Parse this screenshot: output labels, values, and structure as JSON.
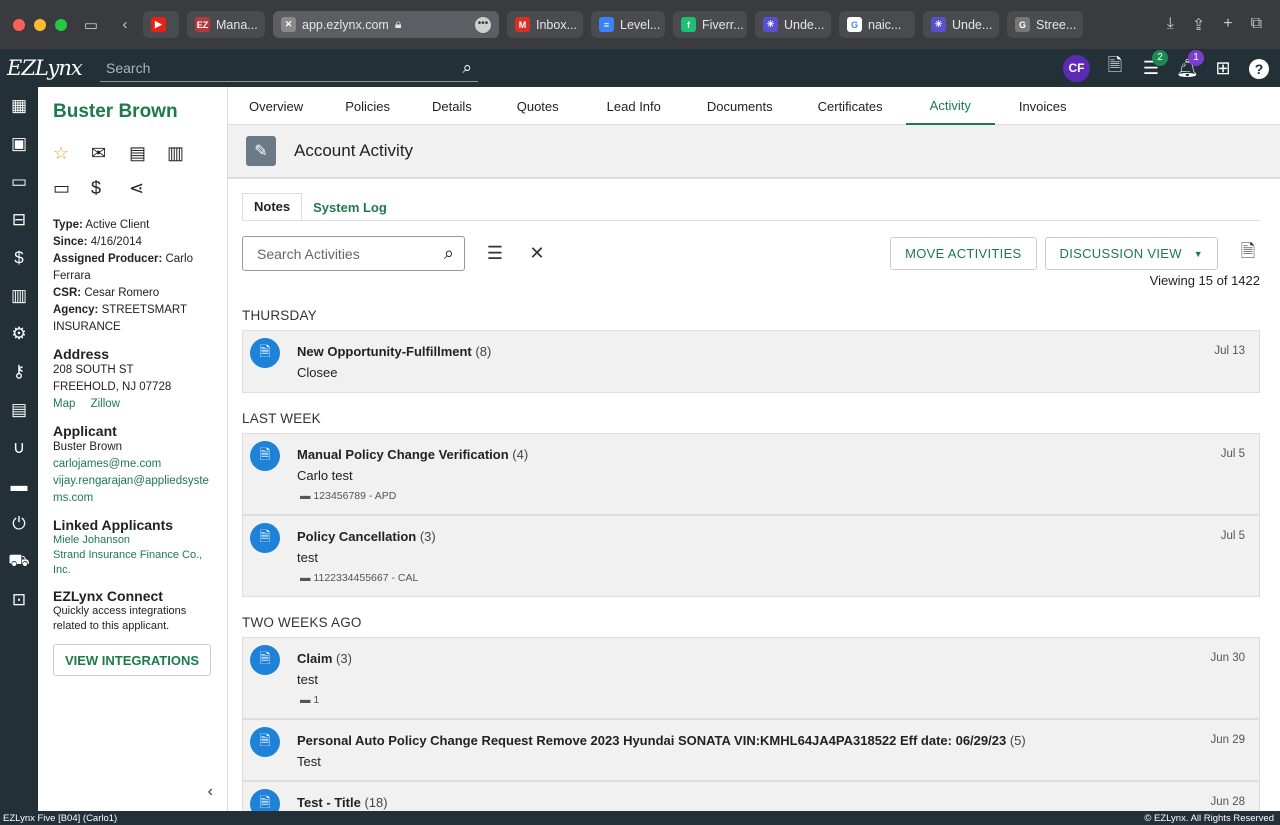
{
  "browser": {
    "tabs": [
      {
        "label": "",
        "fav_color": "#e62117",
        "fav_glyph": "▶"
      },
      {
        "label": "Mana...",
        "fav_color": "#b23a3a",
        "fav_glyph": "EZ"
      },
      {
        "label": "Inbox...",
        "fav_color": "#d93025",
        "fav_glyph": "M"
      },
      {
        "label": "Level...",
        "fav_color": "#3b82f6",
        "fav_glyph": "≡"
      },
      {
        "label": "Fiverr...",
        "fav_color": "#1dbf73",
        "fav_glyph": "f"
      },
      {
        "label": "Unde...",
        "fav_color": "#5a4fcf",
        "fav_glyph": "✳"
      },
      {
        "label": "naic...",
        "fav_color": "#ffffff",
        "fav_glyph": "G"
      },
      {
        "label": "Unde...",
        "fav_color": "#5a4fcf",
        "fav_glyph": "✳"
      },
      {
        "label": "Stree...",
        "fav_color": "#777777",
        "fav_glyph": "G"
      }
    ],
    "address": "app.ezlynx.com"
  },
  "header": {
    "logo": "EZLynx",
    "search_placeholder": "Search",
    "avatar": "CF",
    "tasks_badge": "2",
    "notif_badge": "1"
  },
  "client": {
    "name": "Buster Brown",
    "type_label": "Type:",
    "type": "Active Client",
    "since_label": "Since:",
    "since": "4/16/2014",
    "producer_label": "Assigned Producer:",
    "producer": "Carlo Ferrara",
    "csr_label": "CSR:",
    "csr": "Cesar Romero",
    "agency_label": "Agency:",
    "agency": "STREETSMART INSURANCE"
  },
  "address": {
    "heading": "Address",
    "line1": "208 SOUTH ST",
    "line2": "FREEHOLD, NJ 07728",
    "map": "Map",
    "zillow": "Zillow"
  },
  "applicant": {
    "heading": "Applicant",
    "name": "Buster Brown",
    "email1": "carlojames@me.com",
    "email2": "vijay.rengarajan@appliedsystems.com"
  },
  "linked": {
    "heading": "Linked Applicants",
    "items": [
      "Miele Johanson",
      "Strand Insurance Finance Co., Inc."
    ]
  },
  "connect": {
    "heading": "EZLynx Connect",
    "text": "Quickly access integrations related to this applicant.",
    "button": "VIEW INTEGRATIONS"
  },
  "nav": {
    "tabs": [
      "Overview",
      "Policies",
      "Details",
      "Quotes",
      "Lead Info",
      "Documents",
      "Certificates",
      "Activity",
      "Invoices"
    ],
    "active": "Activity"
  },
  "activity": {
    "title": "Account Activity",
    "subtabs": [
      "Notes",
      "System Log"
    ],
    "search_placeholder": "Search Activities",
    "move_button": "MOVE ACTIVITIES",
    "view_button": "DISCUSSION VIEW",
    "viewing": "Viewing 15 of 1422",
    "groups": [
      "THURSDAY",
      "LAST WEEK",
      "TWO WEEKS AGO"
    ],
    "items": [
      {
        "title": "New Opportunity-Fulfillment",
        "count": "(8)",
        "body": "Closee",
        "ref": "",
        "date": "Jul 13"
      },
      {
        "title": "Manual Policy Change Verification",
        "count": "(4)",
        "body": "Carlo test",
        "ref": "123456789 - APD",
        "date": "Jul 5"
      },
      {
        "title": "Policy Cancellation",
        "count": "(3)",
        "body": "test",
        "ref": "1122334455667 - CAL",
        "date": "Jul 5"
      },
      {
        "title": "Claim",
        "count": "(3)",
        "body": "test",
        "ref": "1",
        "date": "Jun 30"
      },
      {
        "title": "Personal Auto Policy Change Request Remove 2023 Hyundai SONATA VIN:KMHL64JA4PA318522 Eff date: 06/29/23",
        "count": "(5)",
        "body": "Test",
        "ref": "",
        "date": "Jun 29"
      },
      {
        "title": "Test - Title",
        "count": "(18)",
        "body": "",
        "ref": "",
        "date": "Jun 28"
      }
    ]
  },
  "footer": {
    "left": "EZLynx Five [B04] (Carlo1)",
    "right": "© EZLynx. All Rights Reserved"
  }
}
